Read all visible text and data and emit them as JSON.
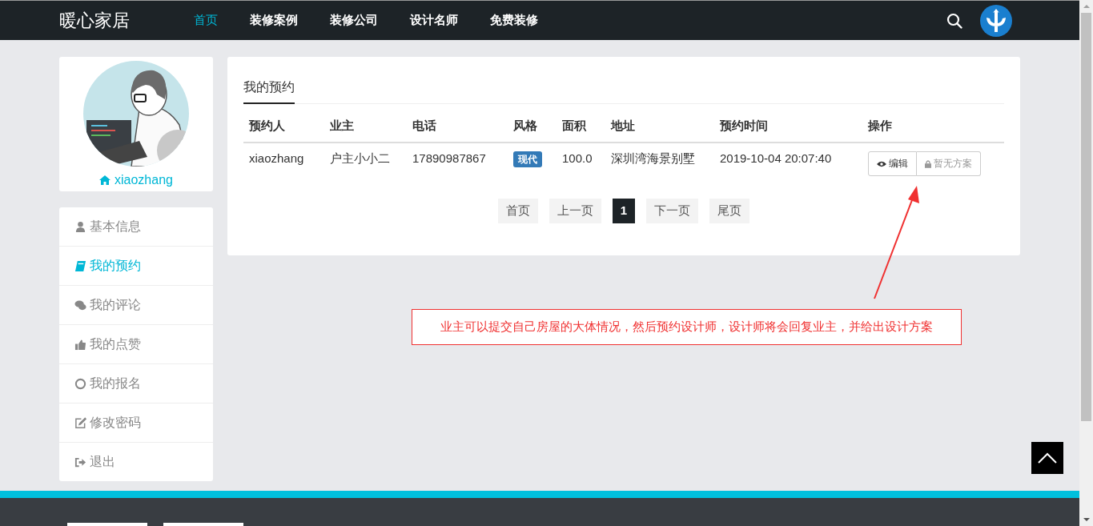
{
  "site": {
    "logo": "暖心家居"
  },
  "nav": [
    {
      "label": "首页",
      "selected": true
    },
    {
      "label": "装修案例",
      "selected": false
    },
    {
      "label": "装修公司",
      "selected": false
    },
    {
      "label": "设计名师",
      "selected": false
    },
    {
      "label": "免费装修",
      "selected": false
    }
  ],
  "profile": {
    "username": "xiaozhang"
  },
  "menu": [
    {
      "label": "基本信息",
      "kind": "user",
      "selected": false
    },
    {
      "label": "我的预约",
      "kind": "book",
      "selected": true
    },
    {
      "label": "我的评论",
      "kind": "comments",
      "selected": false
    },
    {
      "label": "我的点赞",
      "kind": "thumbs",
      "selected": false
    },
    {
      "label": "我的报名",
      "kind": "circle",
      "selected": false
    },
    {
      "label": "修改密码",
      "kind": "edit",
      "selected": false
    },
    {
      "label": "退出",
      "kind": "signout",
      "selected": false
    }
  ],
  "panel": {
    "tab": {
      "label": "我的预约",
      "selected": true
    },
    "table": {
      "columns": [
        "预约人",
        "业主",
        "电话",
        "风格",
        "面积",
        "地址",
        "预约时间",
        "操作"
      ],
      "rows": [
        {
          "booker": "xiaozhang",
          "owner": "户主小小二",
          "phone": "17890987867",
          "style": "现代",
          "area": "100.0",
          "address": "深圳湾海景别墅",
          "time": "2019-10-04 20:07:40",
          "actions": [
            {
              "label": "编辑",
              "kind": "view",
              "disabled": false
            },
            {
              "label": "暂无方案",
              "kind": "lock",
              "disabled": true
            }
          ]
        }
      ]
    },
    "pagination": [
      {
        "label": "首页",
        "selected": false
      },
      {
        "label": "上一页",
        "selected": false
      },
      {
        "label": "1",
        "selected": true
      },
      {
        "label": "下一页",
        "selected": false
      },
      {
        "label": "尾页",
        "selected": false
      }
    ]
  },
  "annotation": {
    "text": "业主可以提交自己房屋的大体情况，然后预约设计师，设计师将会回复业主，并给出设计方案"
  }
}
